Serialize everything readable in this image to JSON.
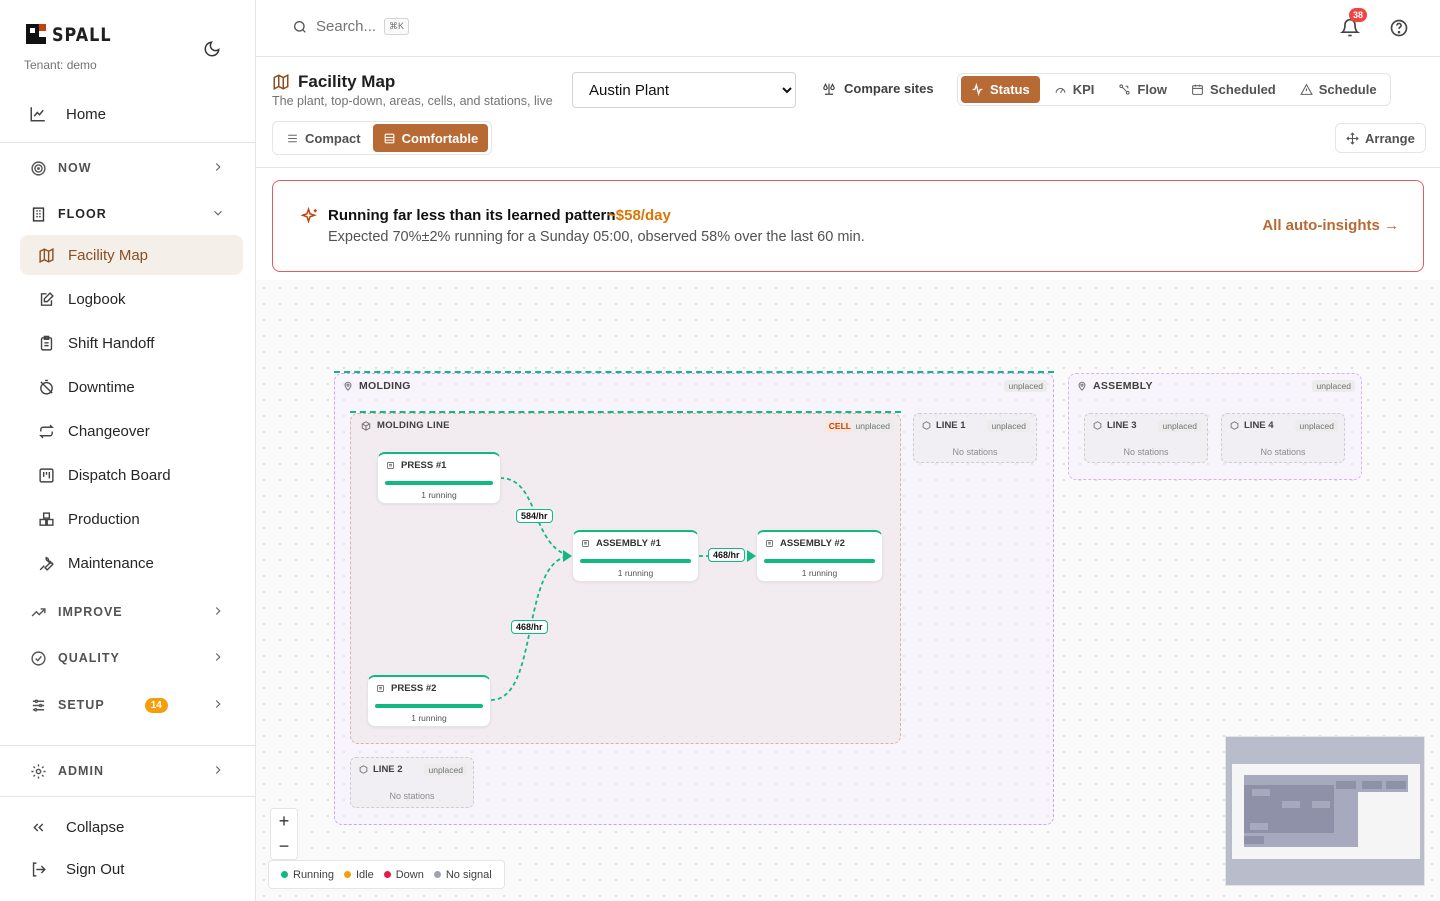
{
  "brand": {
    "name": "SPALL",
    "tenant": "Tenant: demo"
  },
  "sidebar": {
    "home": "Home",
    "groups": {
      "now": "NOW",
      "floor": "FLOOR",
      "improve": "IMPROVE",
      "quality": "QUALITY",
      "setup": "SETUP",
      "setup_badge": "14",
      "admin": "ADMIN"
    },
    "floor_items": [
      "Facility Map",
      "Logbook",
      "Shift Handoff",
      "Downtime",
      "Changeover",
      "Dispatch Board",
      "Production",
      "Maintenance"
    ],
    "collapse": "Collapse",
    "sign_out": "Sign Out"
  },
  "topbar": {
    "search_placeholder": "Search...",
    "search_shortcut": "⌘K",
    "notifications": "38"
  },
  "header": {
    "title": "Facility Map",
    "subtitle": "The plant, top-down, areas, cells, and stations, live",
    "site": "Austin Plant",
    "compare": "Compare sites",
    "tabs": [
      "Status",
      "KPI",
      "Flow",
      "Scheduled",
      "Schedule"
    ],
    "active_tab": "Status",
    "density": [
      "Compact",
      "Comfortable"
    ],
    "active_density": "Comfortable",
    "arrange": "Arrange"
  },
  "insight": {
    "title": "Running far less than its learned pattern",
    "cost": "~$58/day",
    "description": "Expected 70%±2% running for a Sunday 05:00, observed 58% over the last 60 min.",
    "link": "All auto-insights →"
  },
  "map": {
    "areas": {
      "molding": "MOLDING",
      "assembly": "ASSEMBLY",
      "unplaced": "unplaced",
      "cell": "CELL",
      "molding_line": "MOLDING LINE"
    },
    "lines": {
      "line1": "LINE 1",
      "line2": "LINE 2",
      "line3": "LINE 3",
      "line4": "LINE 4",
      "no_stations": "No stations"
    },
    "stations": {
      "press1": {
        "name": "PRESS #1",
        "status": "1 running"
      },
      "press2": {
        "name": "PRESS #2",
        "status": "1 running"
      },
      "assembly1": {
        "name": "ASSEMBLY #1",
        "status": "1 running"
      },
      "assembly2": {
        "name": "ASSEMBLY #2",
        "status": "1 running"
      }
    },
    "flows": {
      "f1": "584/hr",
      "f2": "468/hr",
      "f3": "468/hr"
    },
    "legend": {
      "running": "Running",
      "idle": "Idle",
      "down": "Down",
      "no_signal": "No signal"
    },
    "colors": {
      "running": "#10b981",
      "idle": "#f59e0b",
      "down": "#e11d48",
      "no_signal": "#9ca3af",
      "accent": "#b86a34"
    }
  }
}
